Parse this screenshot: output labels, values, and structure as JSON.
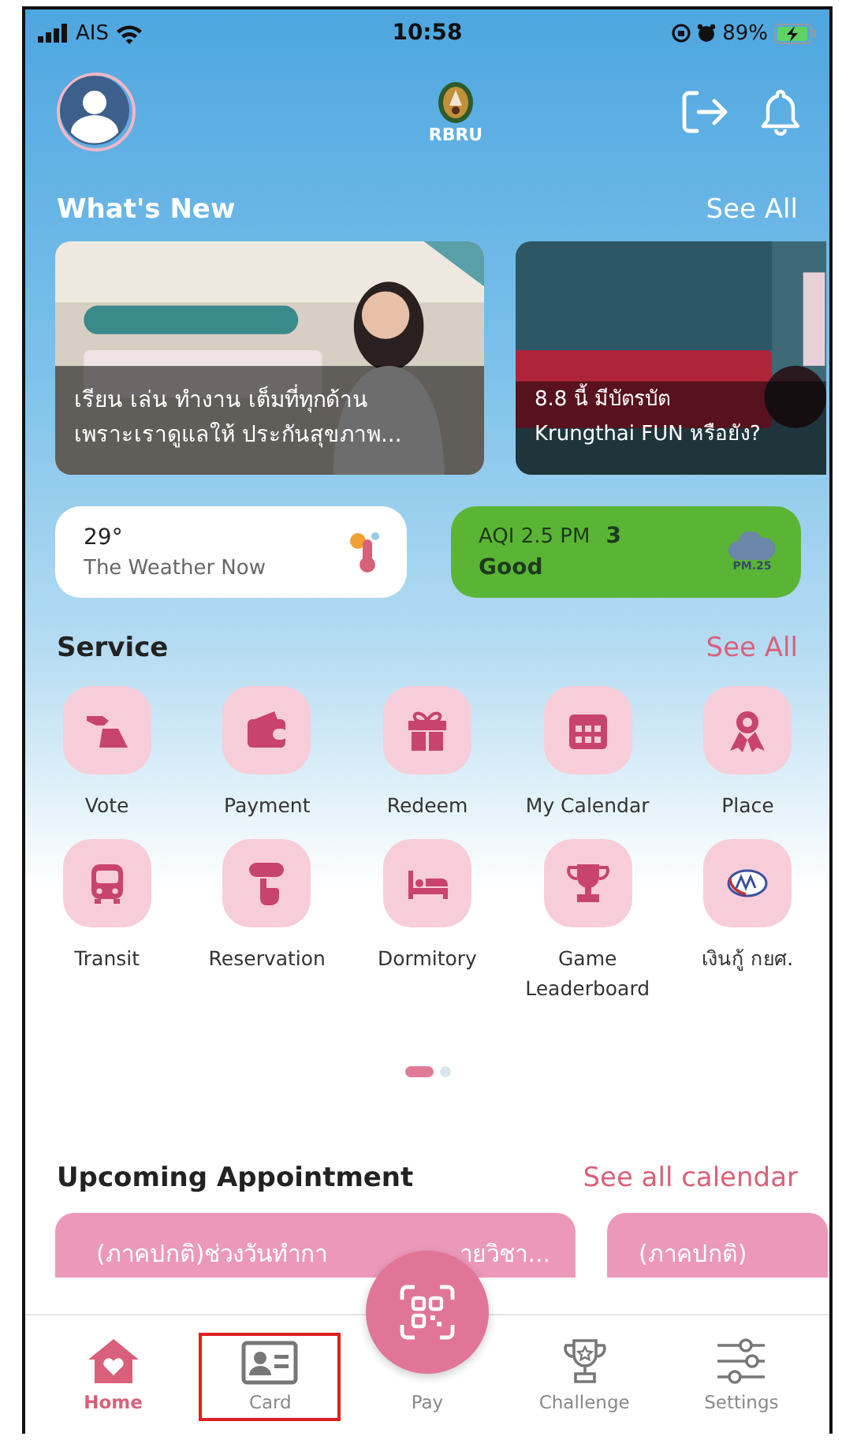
{
  "status_bar": {
    "carrier": "AIS",
    "time": "10:58",
    "battery": "89%"
  },
  "header": {
    "logo_text": "RBRU"
  },
  "whats_new": {
    "title": "What's New",
    "see_all": "See All",
    "items": [
      {
        "kind": "picture",
        "lines": [
          "เรียน เล่น ทำงาน เต็มที่ทุกด้าน",
          "เพราะเราดูแลให้ ประกันสุขภาพ..."
        ]
      },
      {
        "kind": "picture",
        "lines": [
          "8.8 นี้ มีบัตรบัต",
          "Krungthai FUN หรือยัง?"
        ]
      }
    ]
  },
  "weather": {
    "temperature": "29°",
    "label": "The Weather Now"
  },
  "aqi": {
    "label": "AQI 2.5 PM",
    "value": "3",
    "status": "Good",
    "icon_text": "PM.25",
    "color": "#5bb534"
  },
  "service": {
    "title": "Service",
    "see_all": "See All",
    "items": [
      {
        "label": "Vote"
      },
      {
        "label": "Payment"
      },
      {
        "label": "Redeem"
      },
      {
        "label": "My Calendar"
      },
      {
        "label": "Place"
      },
      {
        "label": "Transit"
      },
      {
        "label": "Reservation"
      },
      {
        "label": "Dormitory"
      },
      {
        "label": "Game Leaderboard"
      },
      {
        "label": "เงินกู้ กยศ."
      }
    ]
  },
  "pager": [
    {
      "selected": true
    },
    {
      "selected": false
    }
  ],
  "appointments": {
    "title": "Upcoming Appointment",
    "see_all": "See all calendar",
    "items": [
      {
        "parts": [
          "(ภาคปกติ)ช่วงวันทำกา",
          "ายวิชา..."
        ]
      },
      {
        "parts": [
          "(ภาคปกติ)"
        ]
      }
    ]
  },
  "nav": [
    {
      "kind": "tab",
      "label": "Home",
      "selected": true,
      "highlighted": false
    },
    {
      "kind": "tab",
      "label": "Card",
      "selected": false,
      "highlighted": true
    },
    {
      "kind": "center",
      "label": "Pay",
      "selected": false,
      "highlighted": false
    },
    {
      "kind": "tab",
      "label": "Challenge",
      "selected": false,
      "highlighted": false
    },
    {
      "kind": "tab",
      "label": "Settings",
      "selected": false,
      "highlighted": false
    }
  ]
}
